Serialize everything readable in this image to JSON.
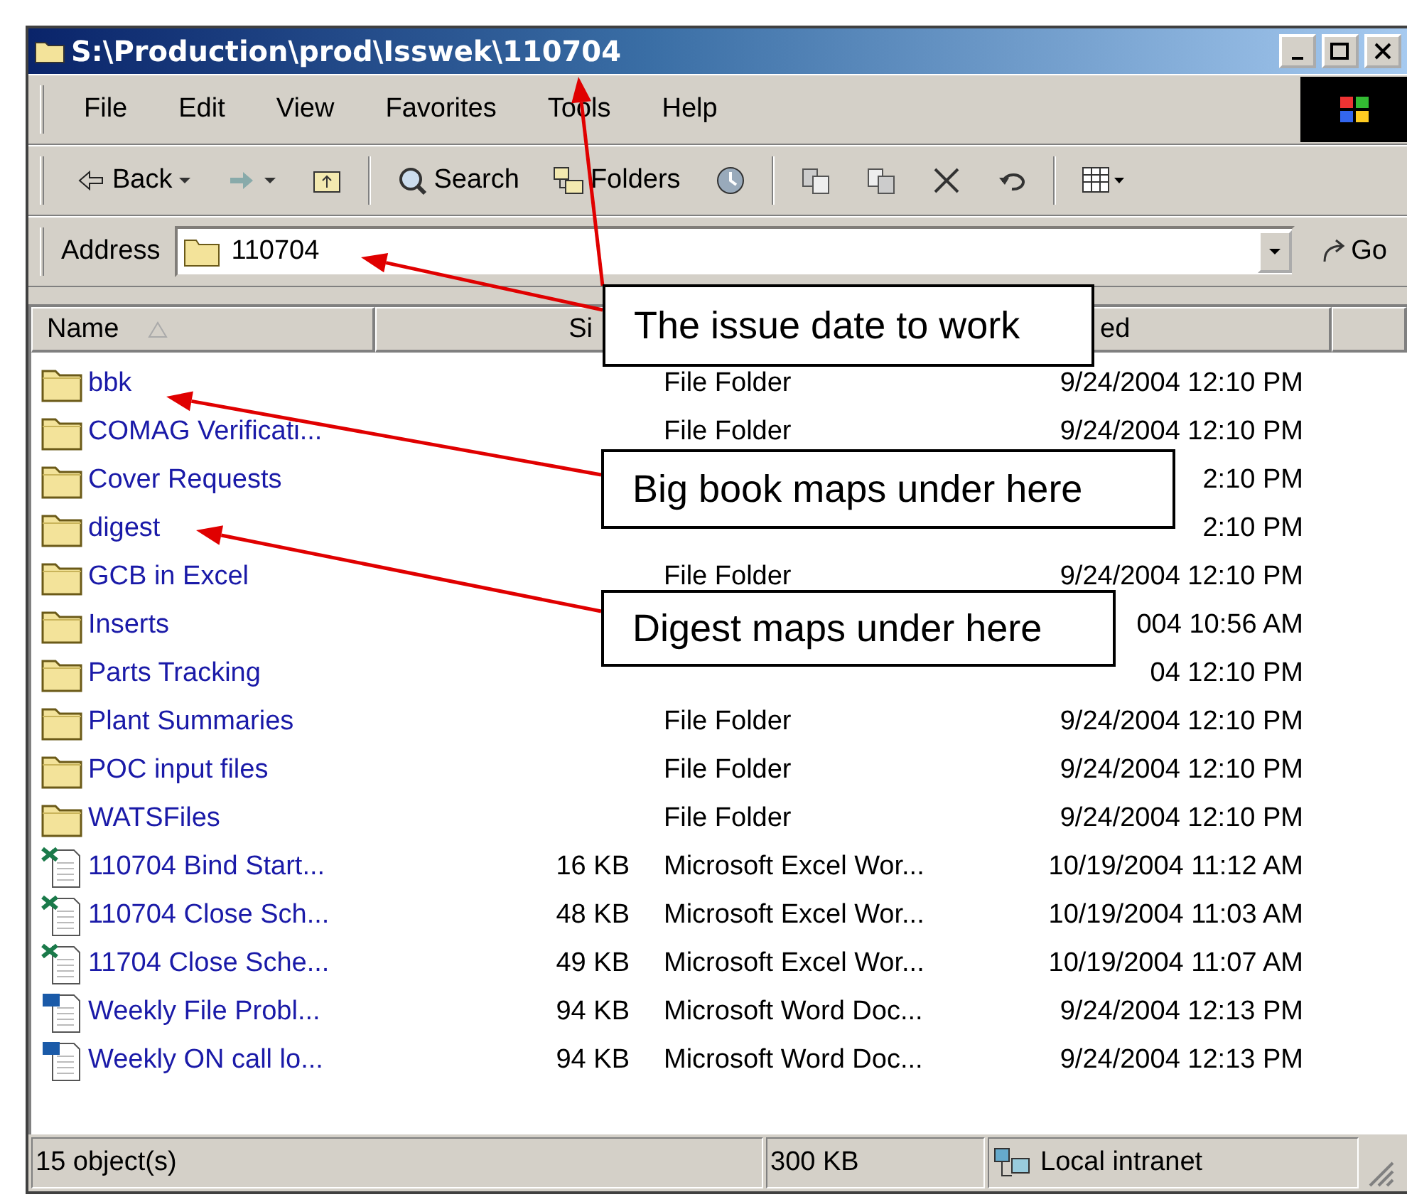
{
  "window": {
    "title": "S:\\Production\\prod\\Isswek\\110704"
  },
  "menu": [
    "File",
    "Edit",
    "View",
    "Favorites",
    "Tools",
    "Help"
  ],
  "toolbar": [
    {
      "kind": "back",
      "label": "Back"
    },
    {
      "kind": "forward"
    },
    {
      "kind": "up"
    },
    {
      "kind": "search",
      "label": "Search"
    },
    {
      "kind": "folders",
      "label": "Folders"
    },
    {
      "kind": "history"
    },
    {
      "kind": "move"
    },
    {
      "kind": "copy"
    },
    {
      "kind": "delete"
    },
    {
      "kind": "undo"
    },
    {
      "kind": "views"
    }
  ],
  "address": {
    "label": "Address",
    "value": "110704",
    "go": "Go"
  },
  "header": {
    "name": "Name",
    "size": "Si",
    "modified": "ed"
  },
  "rows": [
    {
      "kind": "folder",
      "name": "bbk",
      "type": "File Folder",
      "modified": "9/24/2004 12:10 PM"
    },
    {
      "kind": "folder",
      "name": "COMAG Verificati...",
      "type": "File Folder",
      "modified": "9/24/2004 12:10 PM"
    },
    {
      "kind": "folder",
      "name": "Cover  Requests",
      "modified": "2:10 PM"
    },
    {
      "kind": "folder",
      "name": "digest",
      "modified": "2:10 PM"
    },
    {
      "kind": "folder",
      "name": "GCB in Excel",
      "type": "File Folder",
      "modified": "9/24/2004 12:10 PM"
    },
    {
      "kind": "folder",
      "name": "Inserts",
      "modified": "004 10:56 AM"
    },
    {
      "kind": "folder",
      "name": "Parts Tracking",
      "modified": "04 12:10 PM"
    },
    {
      "kind": "folder",
      "name": "Plant Summaries",
      "type": "File Folder",
      "modified": "9/24/2004 12:10 PM"
    },
    {
      "kind": "folder",
      "name": "POC input files",
      "type": "File Folder",
      "modified": "9/24/2004 12:10 PM"
    },
    {
      "kind": "folder",
      "name": "WATSFiles",
      "type": "File Folder",
      "modified": "9/24/2004 12:10 PM"
    },
    {
      "kind": "excel",
      "name": "110704 Bind Start...",
      "size": "16 KB",
      "type": "Microsoft Excel Wor...",
      "modified": "10/19/2004 11:12 AM"
    },
    {
      "kind": "excel",
      "name": "110704 Close Sch...",
      "size": "48 KB",
      "type": "Microsoft Excel Wor...",
      "modified": "10/19/2004 11:03 AM"
    },
    {
      "kind": "excel",
      "name": "11704 Close Sche...",
      "size": "49 KB",
      "type": "Microsoft Excel Wor...",
      "modified": "10/19/2004 11:07 AM"
    },
    {
      "kind": "word",
      "name": "Weekly File Probl...",
      "size": "94 KB",
      "type": "Microsoft Word Doc...",
      "modified": "9/24/2004 12:13 PM"
    },
    {
      "kind": "word",
      "name": "Weekly ON call lo...",
      "size": "94 KB",
      "type": "Microsoft Word Doc...",
      "modified": "9/24/2004 12:13 PM"
    }
  ],
  "status": {
    "objects": "15 object(s)",
    "size": "300 KB",
    "zone": "Local intranet"
  },
  "callouts": [
    {
      "text": "The issue date to work"
    },
    {
      "text": "Big book maps under here"
    },
    {
      "text": "Digest maps under here"
    }
  ]
}
